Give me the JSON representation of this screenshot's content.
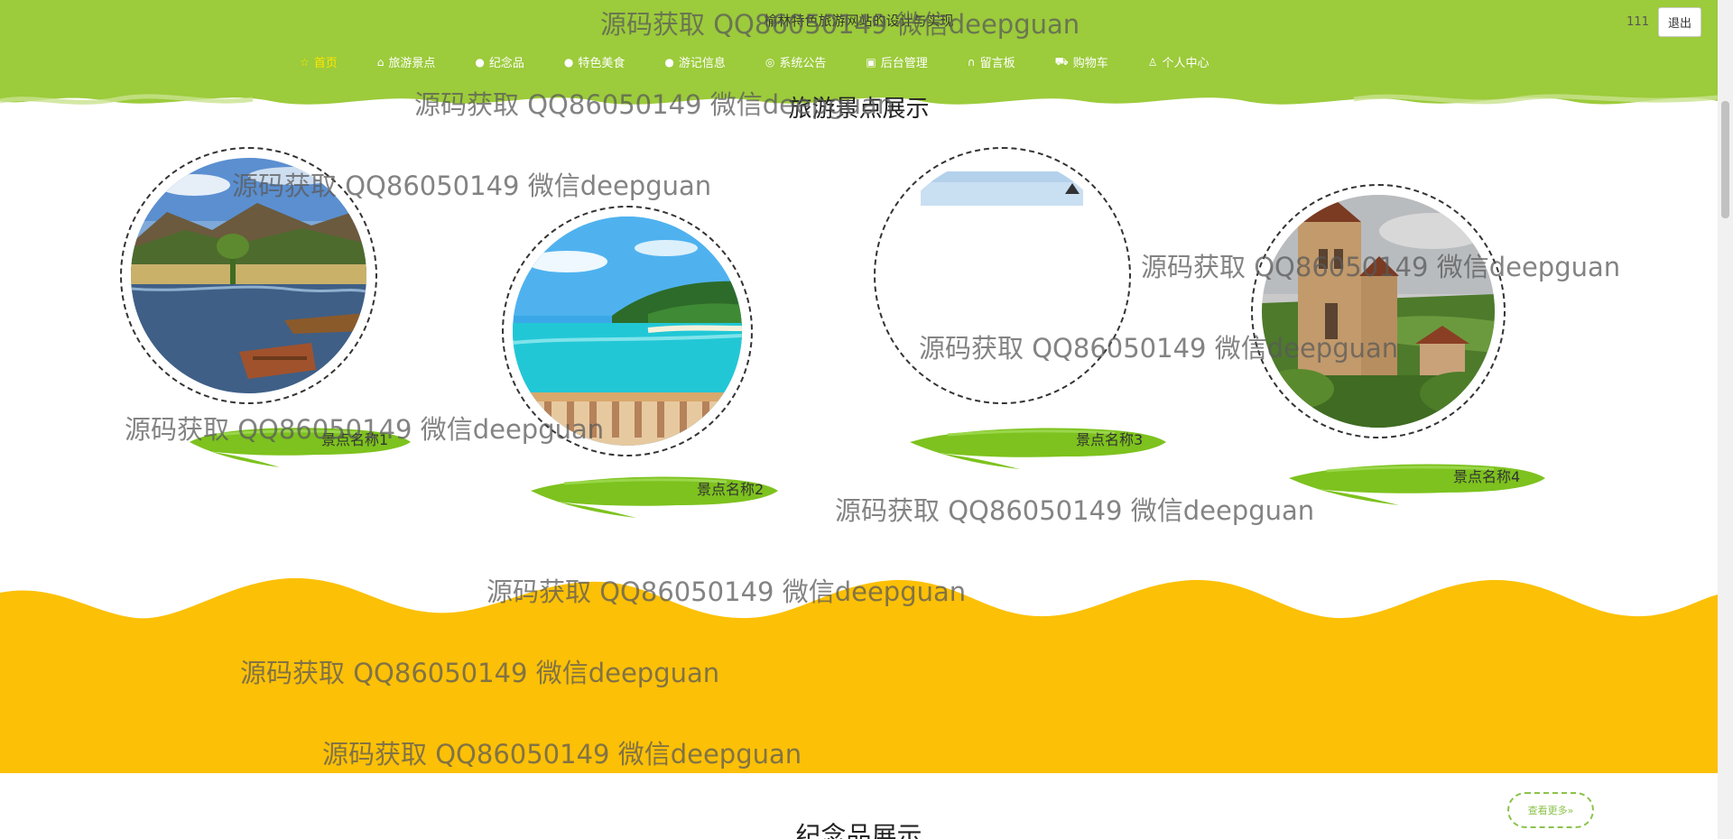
{
  "header": {
    "site_title": "榆林特色旅游网站的设计与实现",
    "user_name": "111",
    "logout_label": "退出",
    "bg_color": "#9ccb3b"
  },
  "nav": {
    "items": [
      {
        "label": "首页",
        "icon": "star-icon"
      },
      {
        "label": "旅游景点",
        "icon": "bag-icon"
      },
      {
        "label": "纪念品",
        "icon": "info-icon"
      },
      {
        "label": "特色美食",
        "icon": "question-icon"
      },
      {
        "label": "游记信息",
        "icon": "info-icon"
      },
      {
        "label": "系统公告",
        "icon": "globe-icon"
      },
      {
        "label": "后台管理",
        "icon": "lock-icon"
      },
      {
        "label": "留言板",
        "icon": "headset-icon"
      },
      {
        "label": "购物车",
        "icon": "cart-icon"
      },
      {
        "label": "个人中心",
        "icon": "user-icon"
      }
    ],
    "active_color": "#ffe600"
  },
  "spots_section": {
    "title": "旅游景点展示",
    "spots": [
      {
        "name": "景点名称1"
      },
      {
        "name": "景点名称2"
      },
      {
        "name": "景点名称3"
      },
      {
        "name": "景点名称4"
      }
    ],
    "brush_color": "#7dc21e"
  },
  "band": {
    "color": "#fcc006"
  },
  "souvenir_section": {
    "title": "纪念品展示",
    "more_label": "查看更多»"
  },
  "watermark": {
    "text": "源码获取 QQ86050149 微信deepguan"
  }
}
